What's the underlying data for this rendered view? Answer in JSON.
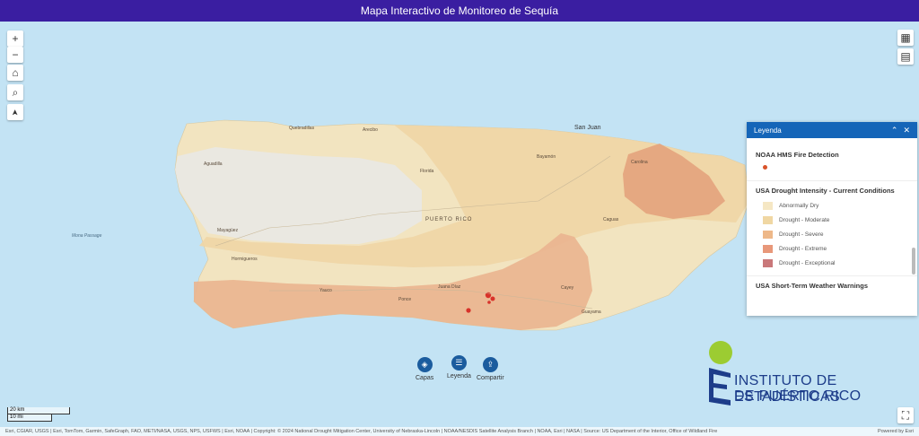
{
  "header": {
    "title": "Mapa Interactivo de Monitoreo de Sequía"
  },
  "controls": {
    "zoom_in": "+",
    "zoom_out": "−",
    "home": "⌂",
    "search": "⌕",
    "compass": "➤",
    "grid": "▦",
    "basemap": "▤",
    "fullscreen": "⛶"
  },
  "map_labels": {
    "san_juan": "San Juan",
    "quebradillas": "Quebradillas",
    "arecibo": "Arecibo",
    "aguadilla": "Aguadilla",
    "mayaguez": "Mayagüez",
    "ponce": "Ponce",
    "cayey": "Cayey",
    "carolina": "Carolina",
    "bayamon": "Bayamón",
    "guayama": "Guayama",
    "puerto_rico": "PUERTO RICO",
    "mona_passage": "Mona Passage",
    "hormigueros": "Hormigueros",
    "juana_diaz": "Juana Díaz",
    "caguas": "Caguas",
    "yauco": "Yauco",
    "florida": "Florida"
  },
  "legend": {
    "title": "Leyenda",
    "collapse_icon": "⌃",
    "close_icon": "✕",
    "fire_section": "NOAA HMS Fire Detection",
    "drought_section": "USA Drought Intensity - Current Conditions",
    "drought_items": [
      {
        "label": "Abnormally Dry",
        "color": "#f5e7c4"
      },
      {
        "label": "Drought - Moderate",
        "color": "#f0d7a3"
      },
      {
        "label": "Drought - Severe",
        "color": "#eeb889"
      },
      {
        "label": "Drought - Extreme",
        "color": "#e8987a"
      },
      {
        "label": "Drought - Exceptional",
        "color": "#c9787a"
      }
    ],
    "weather_section": "USA Short-Term Weather Warnings"
  },
  "widgets": {
    "layers": {
      "label": "Capas",
      "icon": "◈"
    },
    "legend": {
      "label": "Leyenda",
      "icon": "☰"
    },
    "share": {
      "label": "Compartir",
      "icon": "⇪"
    }
  },
  "scale": {
    "km": "20 km",
    "mi": "10 mi"
  },
  "brand": {
    "line1": "INSTITUTO DE ESTADÍSTICAS",
    "line2": "DE PUERTO RICO",
    "dot_color": "#9ccc32",
    "text_color": "#1d3d8a"
  },
  "attribution": {
    "text": "Esri, CGIAR, USGS | Esri, TomTom, Garmin, SafeGraph, FAO, METI/NASA, USGS, NPS, USFWS | Esri, NOAA | Copyright: © 2024 National Drought Mitigation Center, University of Nebraska-Lincoln | NOAA/NESDIS Satellite Analysis Branch | NOAA, Esri | NASA | Source: US Department of the Interior, Office of Wildland Fire",
    "powered": "Powered by Esri"
  }
}
